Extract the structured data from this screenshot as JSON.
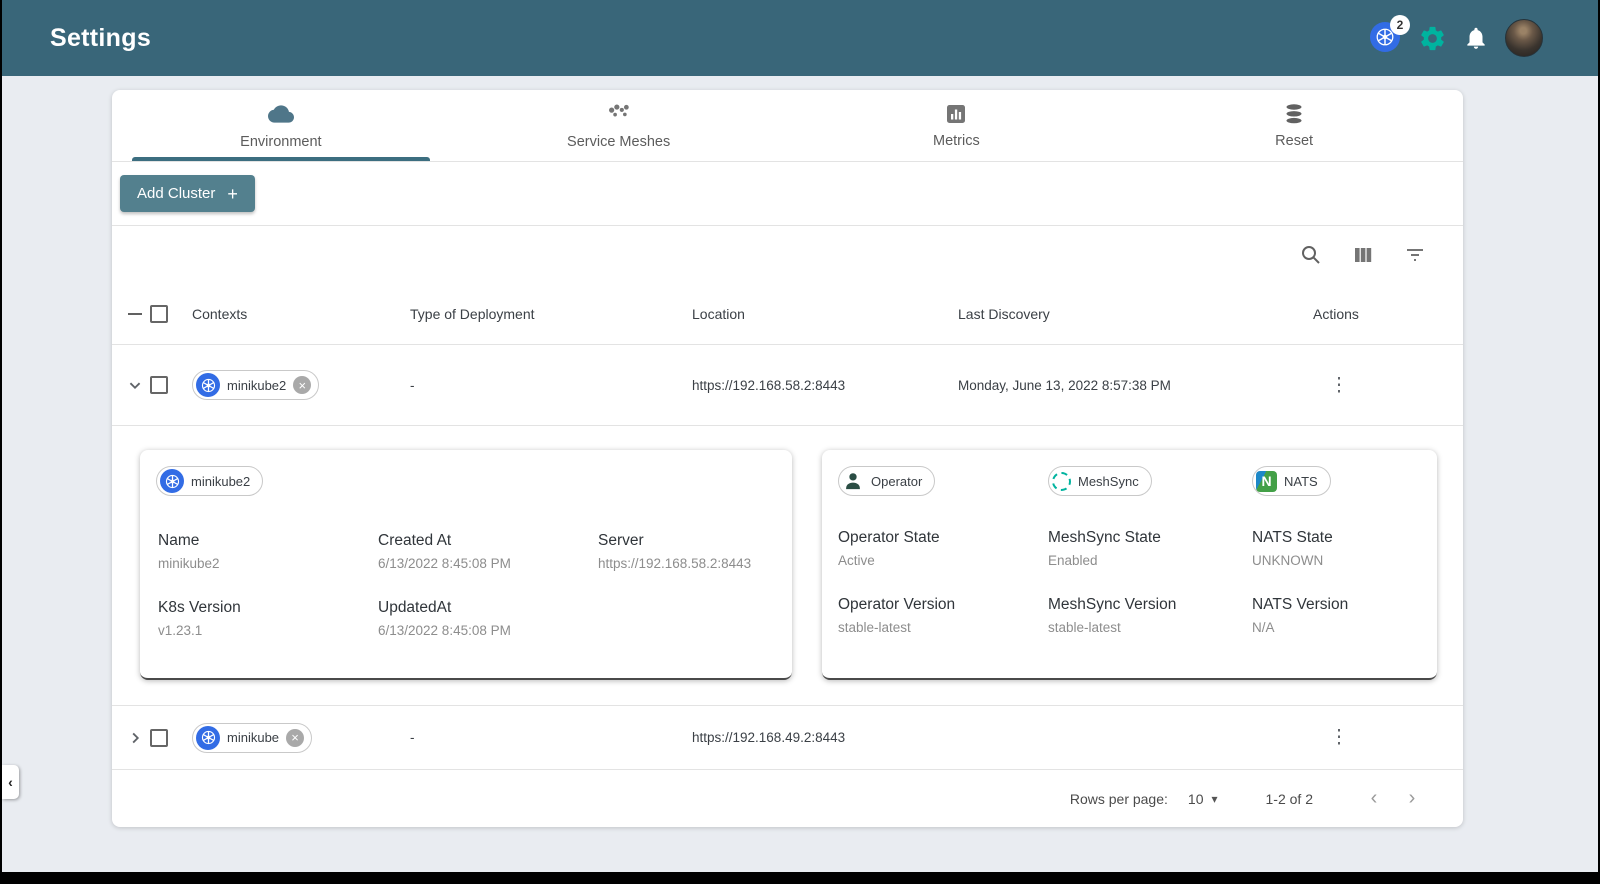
{
  "colors": {
    "appbar": "#396679",
    "accent_green": "#00b39f",
    "kubernetes_blue": "#326ce5",
    "button": "#53808e"
  },
  "appbar": {
    "title": "Settings",
    "kubernetes_badge": "2"
  },
  "tabs": [
    {
      "label": "Environment"
    },
    {
      "label": "Service Meshes"
    },
    {
      "label": "Metrics"
    },
    {
      "label": "Reset"
    }
  ],
  "actions_bar": {
    "add_cluster_label": "Add Cluster",
    "plus": "+"
  },
  "table": {
    "headers": [
      "Contexts",
      "Type of Deployment",
      "Location",
      "Last Discovery",
      "Actions"
    ],
    "rows": [
      {
        "context": "minikube2",
        "type_of_deployment": "-",
        "location": "https://192.168.58.2:8443",
        "last_discovery": "Monday, June 13, 2022 8:57:38 PM"
      },
      {
        "context": "minikube",
        "type_of_deployment": "-",
        "location": "https://192.168.49.2:8443",
        "last_discovery": ""
      }
    ]
  },
  "details": {
    "cluster_chip": "minikube2",
    "status_chips": [
      "Operator",
      "MeshSync",
      "NATS"
    ],
    "fields_left": [
      {
        "label": "Name",
        "value": "minikube2"
      },
      {
        "label": "Created At",
        "value": "6/13/2022 8:45:08 PM"
      },
      {
        "label": "Server",
        "value": "https://192.168.58.2:8443"
      },
      {
        "label": "K8s Version",
        "value": "v1.23.1"
      },
      {
        "label": "UpdatedAt",
        "value": "6/13/2022 8:45:08 PM"
      }
    ],
    "fields_right": [
      {
        "label": "Operator State",
        "value": "Active"
      },
      {
        "label": "MeshSync State",
        "value": "Enabled"
      },
      {
        "label": "NATS State",
        "value": "UNKNOWN"
      },
      {
        "label": "Operator Version",
        "value": "stable-latest"
      },
      {
        "label": "MeshSync Version",
        "value": "stable-latest"
      },
      {
        "label": "NATS Version",
        "value": "N/A"
      }
    ]
  },
  "pagination": {
    "rows_per_page_label": "Rows per page:",
    "rows_per_page_value": "10",
    "range": "1-2 of 2"
  },
  "glyphs": {
    "close": "×",
    "dots_menu": "⋮",
    "caret_down": "▾",
    "chevron_left": "‹",
    "chevron_right": "›",
    "nats_letter": "N"
  }
}
